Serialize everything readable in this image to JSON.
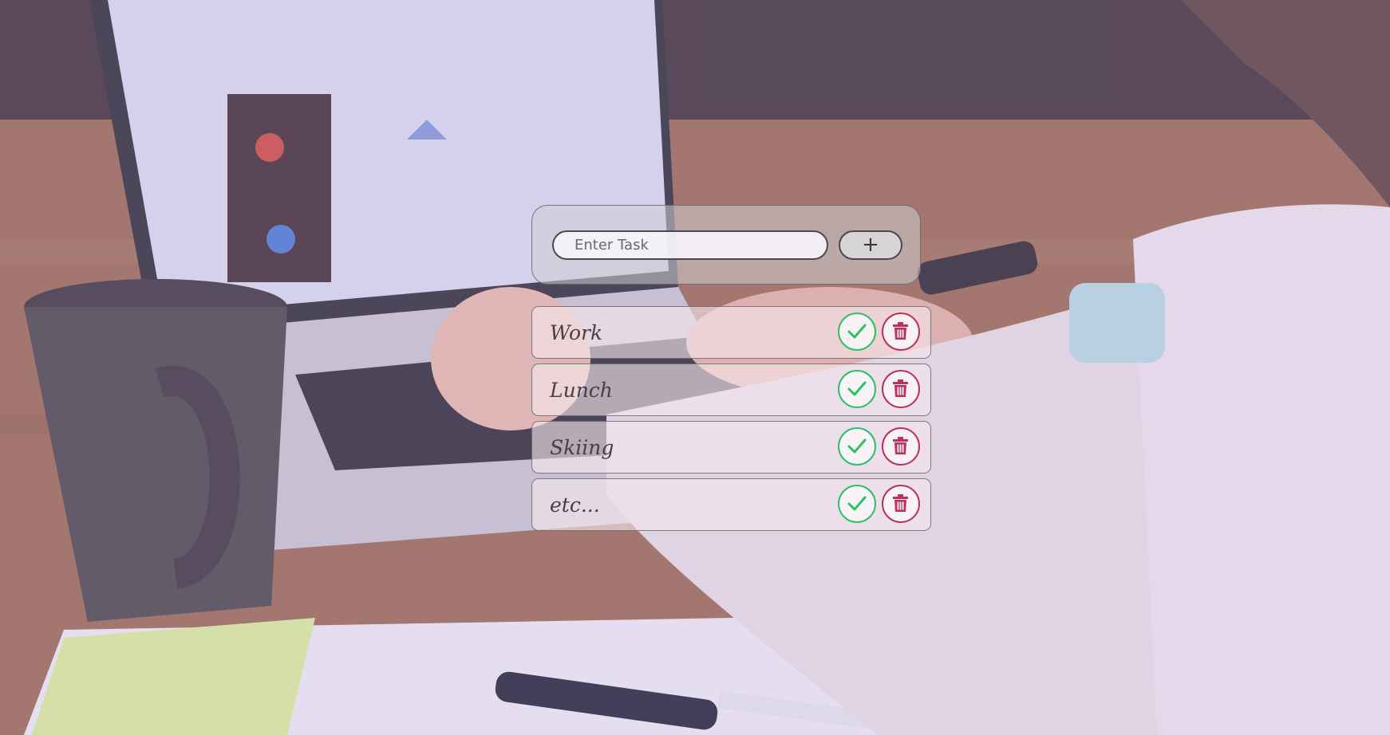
{
  "input": {
    "placeholder": "Enter Task",
    "add_label": "+"
  },
  "tasks": [
    {
      "label": "Work"
    },
    {
      "label": "Lunch"
    },
    {
      "label": "Skiing"
    },
    {
      "label": "etc..."
    }
  ],
  "icons": {
    "done": "check-icon",
    "delete": "trash-icon"
  },
  "colors": {
    "done": "#2fbf6a",
    "delete": "#b8325e"
  }
}
